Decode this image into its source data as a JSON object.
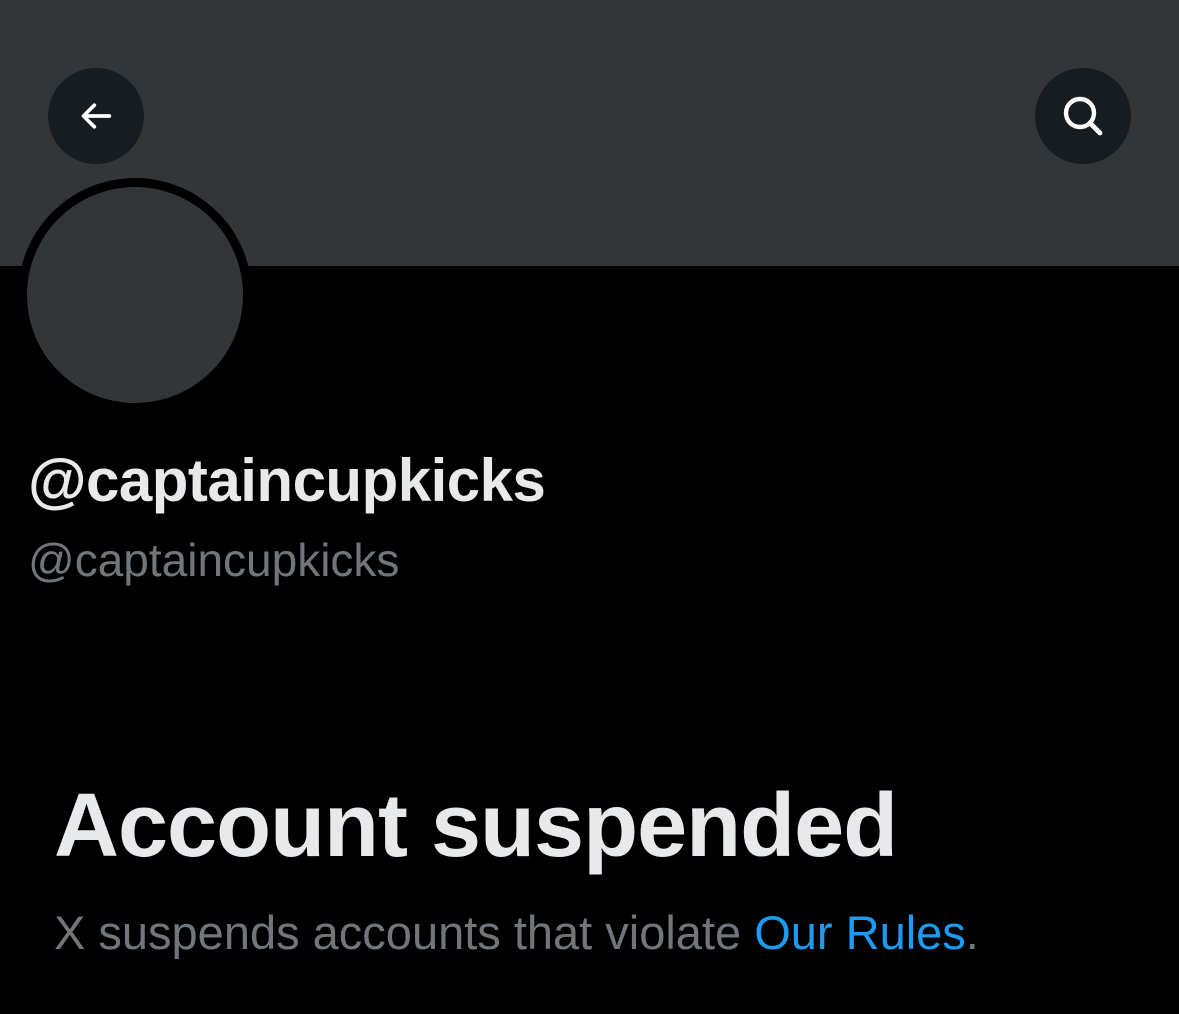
{
  "profile": {
    "display_name": "@captaincupkicks",
    "handle": "@captaincupkicks"
  },
  "header": {
    "back_icon": "arrow-left-icon",
    "search_icon": "search-icon"
  },
  "suspension": {
    "title": "Account suspended",
    "text_before": "X suspends accounts that violate ",
    "link_text": "Our Rules",
    "text_after": "."
  },
  "colors": {
    "background": "#000000",
    "banner": "#333639",
    "primary_text": "#e7e9ea",
    "secondary_text": "#71767b",
    "link": "#1d9bf0"
  }
}
